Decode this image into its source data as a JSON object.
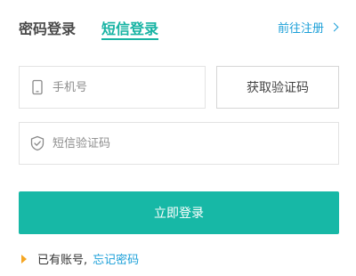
{
  "tabs": {
    "password_login": "密码登录",
    "sms_login": "短信登录"
  },
  "register": {
    "label": "前往注册",
    "icon": "chevron-right-icon"
  },
  "phone": {
    "placeholder": "手机号",
    "icon": "phone-icon"
  },
  "get_code_button": "获取验证码",
  "sms_code": {
    "placeholder": "短信验证码",
    "icon": "shield-icon"
  },
  "login_button": "立即登录",
  "footer": {
    "has_account_text": "已有账号,",
    "forgot_password": "忘记密码"
  },
  "colors": {
    "accent": "#17b8a6",
    "link": "#1a9fd8",
    "marker": "#f5a623"
  }
}
